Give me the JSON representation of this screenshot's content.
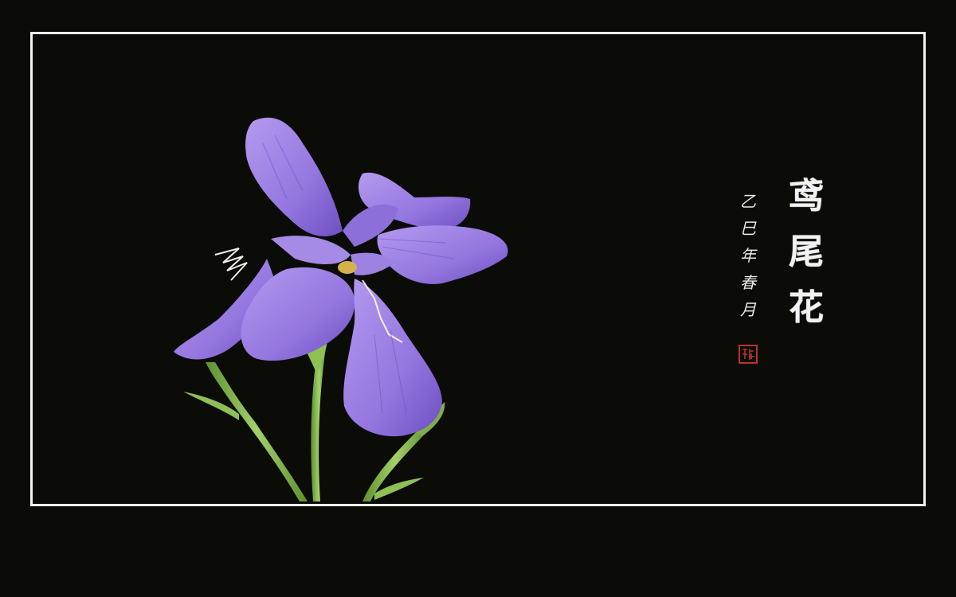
{
  "artwork": {
    "title_chars": [
      "鸢",
      "尾",
      "花"
    ],
    "date_chars": [
      "乙",
      "巳",
      "年",
      "春",
      "月"
    ],
    "colors": {
      "background": "#0b0b07",
      "frame": "#f4f4f2",
      "petal": "#9b7fe0",
      "petal_dark": "#5f43b0",
      "stem": "#7fb34a",
      "seal": "#b8322b"
    },
    "image_description_icon": "iris-flower-illustration",
    "seal_icon": "red-seal-stamp"
  }
}
